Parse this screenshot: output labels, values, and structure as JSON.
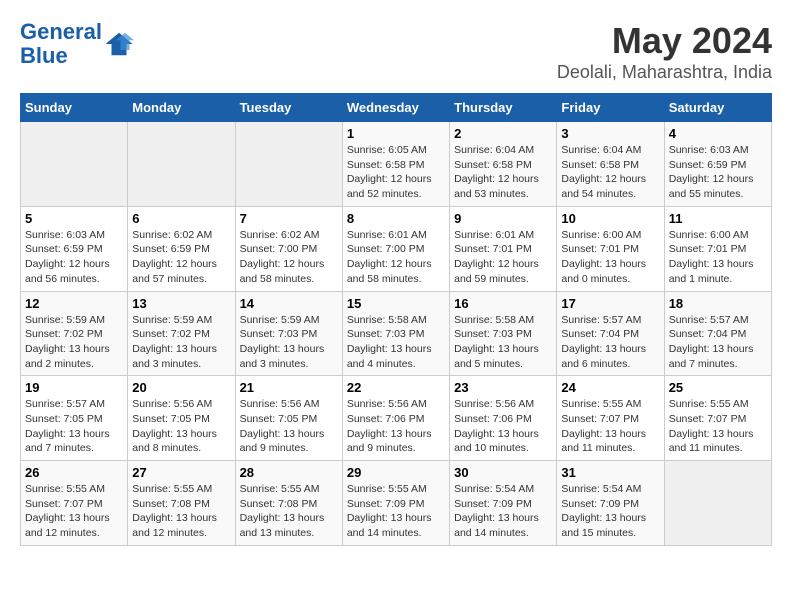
{
  "header": {
    "logo_line1": "General",
    "logo_line2": "Blue",
    "title": "May 2024",
    "subtitle": "Deolali, Maharashtra, India"
  },
  "calendar": {
    "days_of_week": [
      "Sunday",
      "Monday",
      "Tuesday",
      "Wednesday",
      "Thursday",
      "Friday",
      "Saturday"
    ],
    "weeks": [
      [
        {
          "day": "",
          "detail": ""
        },
        {
          "day": "",
          "detail": ""
        },
        {
          "day": "",
          "detail": ""
        },
        {
          "day": "1",
          "detail": "Sunrise: 6:05 AM\nSunset: 6:58 PM\nDaylight: 12 hours\nand 52 minutes."
        },
        {
          "day": "2",
          "detail": "Sunrise: 6:04 AM\nSunset: 6:58 PM\nDaylight: 12 hours\nand 53 minutes."
        },
        {
          "day": "3",
          "detail": "Sunrise: 6:04 AM\nSunset: 6:58 PM\nDaylight: 12 hours\nand 54 minutes."
        },
        {
          "day": "4",
          "detail": "Sunrise: 6:03 AM\nSunset: 6:59 PM\nDaylight: 12 hours\nand 55 minutes."
        }
      ],
      [
        {
          "day": "5",
          "detail": "Sunrise: 6:03 AM\nSunset: 6:59 PM\nDaylight: 12 hours\nand 56 minutes."
        },
        {
          "day": "6",
          "detail": "Sunrise: 6:02 AM\nSunset: 6:59 PM\nDaylight: 12 hours\nand 57 minutes."
        },
        {
          "day": "7",
          "detail": "Sunrise: 6:02 AM\nSunset: 7:00 PM\nDaylight: 12 hours\nand 58 minutes."
        },
        {
          "day": "8",
          "detail": "Sunrise: 6:01 AM\nSunset: 7:00 PM\nDaylight: 12 hours\nand 58 minutes."
        },
        {
          "day": "9",
          "detail": "Sunrise: 6:01 AM\nSunset: 7:01 PM\nDaylight: 12 hours\nand 59 minutes."
        },
        {
          "day": "10",
          "detail": "Sunrise: 6:00 AM\nSunset: 7:01 PM\nDaylight: 13 hours\nand 0 minutes."
        },
        {
          "day": "11",
          "detail": "Sunrise: 6:00 AM\nSunset: 7:01 PM\nDaylight: 13 hours\nand 1 minute."
        }
      ],
      [
        {
          "day": "12",
          "detail": "Sunrise: 5:59 AM\nSunset: 7:02 PM\nDaylight: 13 hours\nand 2 minutes."
        },
        {
          "day": "13",
          "detail": "Sunrise: 5:59 AM\nSunset: 7:02 PM\nDaylight: 13 hours\nand 3 minutes."
        },
        {
          "day": "14",
          "detail": "Sunrise: 5:59 AM\nSunset: 7:03 PM\nDaylight: 13 hours\nand 3 minutes."
        },
        {
          "day": "15",
          "detail": "Sunrise: 5:58 AM\nSunset: 7:03 PM\nDaylight: 13 hours\nand 4 minutes."
        },
        {
          "day": "16",
          "detail": "Sunrise: 5:58 AM\nSunset: 7:03 PM\nDaylight: 13 hours\nand 5 minutes."
        },
        {
          "day": "17",
          "detail": "Sunrise: 5:57 AM\nSunset: 7:04 PM\nDaylight: 13 hours\nand 6 minutes."
        },
        {
          "day": "18",
          "detail": "Sunrise: 5:57 AM\nSunset: 7:04 PM\nDaylight: 13 hours\nand 7 minutes."
        }
      ],
      [
        {
          "day": "19",
          "detail": "Sunrise: 5:57 AM\nSunset: 7:05 PM\nDaylight: 13 hours\nand 7 minutes."
        },
        {
          "day": "20",
          "detail": "Sunrise: 5:56 AM\nSunset: 7:05 PM\nDaylight: 13 hours\nand 8 minutes."
        },
        {
          "day": "21",
          "detail": "Sunrise: 5:56 AM\nSunset: 7:05 PM\nDaylight: 13 hours\nand 9 minutes."
        },
        {
          "day": "22",
          "detail": "Sunrise: 5:56 AM\nSunset: 7:06 PM\nDaylight: 13 hours\nand 9 minutes."
        },
        {
          "day": "23",
          "detail": "Sunrise: 5:56 AM\nSunset: 7:06 PM\nDaylight: 13 hours\nand 10 minutes."
        },
        {
          "day": "24",
          "detail": "Sunrise: 5:55 AM\nSunset: 7:07 PM\nDaylight: 13 hours\nand 11 minutes."
        },
        {
          "day": "25",
          "detail": "Sunrise: 5:55 AM\nSunset: 7:07 PM\nDaylight: 13 hours\nand 11 minutes."
        }
      ],
      [
        {
          "day": "26",
          "detail": "Sunrise: 5:55 AM\nSunset: 7:07 PM\nDaylight: 13 hours\nand 12 minutes."
        },
        {
          "day": "27",
          "detail": "Sunrise: 5:55 AM\nSunset: 7:08 PM\nDaylight: 13 hours\nand 12 minutes."
        },
        {
          "day": "28",
          "detail": "Sunrise: 5:55 AM\nSunset: 7:08 PM\nDaylight: 13 hours\nand 13 minutes."
        },
        {
          "day": "29",
          "detail": "Sunrise: 5:55 AM\nSunset: 7:09 PM\nDaylight: 13 hours\nand 14 minutes."
        },
        {
          "day": "30",
          "detail": "Sunrise: 5:54 AM\nSunset: 7:09 PM\nDaylight: 13 hours\nand 14 minutes."
        },
        {
          "day": "31",
          "detail": "Sunrise: 5:54 AM\nSunset: 7:09 PM\nDaylight: 13 hours\nand 15 minutes."
        },
        {
          "day": "",
          "detail": ""
        }
      ]
    ]
  }
}
